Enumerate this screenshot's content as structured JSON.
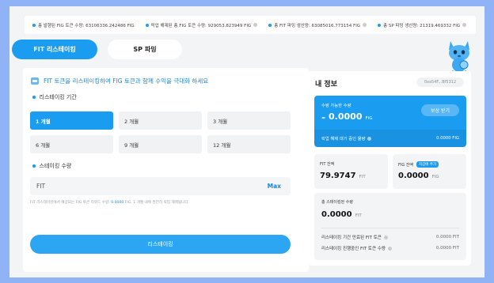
{
  "ticker": [
    {
      "label": "총 발행된 FIG 토큰 수량: 63106336.242486 FIG",
      "help": false
    },
    {
      "label": "락업 해제된 총 FIG 토큰 수량: 929053.823949 FIG",
      "help": true
    },
    {
      "label": "총 FIT 파밍 생산량: 63085016.773154 FIG",
      "help": true
    },
    {
      "label": "총 SP 파밍 생산량: 21319.469332 FIG",
      "help": true
    }
  ],
  "tabs": {
    "active": "FIT 리스테이킹",
    "idle": "SP 파밍"
  },
  "left": {
    "promo": "FIT 토큰을 리스테이킹하여 FIG 토큰과 함께 수익을 극대화 하세요",
    "period_label": "리스테이킹 기간",
    "periods": [
      "1 개월",
      "2 개월",
      "3 개월",
      "6 개월",
      "9 개월",
      "12 개월"
    ],
    "amount_label": "스테이킹 수량",
    "amount_unit": "FIT",
    "amount_max": "Max",
    "note_before": "FIT 리스테이킹에서 예상되는 FIG 토큰 리워드 수량: ",
    "note_value": "0.0000",
    "note_after": " FIG, 1 개월 내에 완전히 락업 해제됩니다.",
    "cta": "리스테이킹"
  },
  "right": {
    "title": "내 정보",
    "wallet": "0xa54F...Bf5312",
    "claimable_label": "수령 가능한 수량",
    "claimable_prefix": "≈",
    "claimable_value": "0.0000",
    "claimable_unit": "FIG",
    "claim_button": "보상 받기",
    "pending_label": "락업 해제 대기 중인 물량",
    "pending_value": "0.0000 FIG",
    "fit_balance_label": "FIT 잔액",
    "fit_balance_value": "79.9747",
    "fit_balance_unit": "FIT",
    "fig_balance_label": "FIG 잔액",
    "fig_badge": "지갑에 추가",
    "fig_balance_value": "0.0000",
    "fig_balance_unit": "FIG",
    "total_label": "총 스테이킹된 수량",
    "total_value": "0.0000",
    "total_unit": "FIT",
    "expired_label": "리스테이킹 기간 만료된 FIT 토큰",
    "expired_value": "0.0000 FIT",
    "active_label": "리스테이킹 진행중인 FIT 토큰 수량",
    "active_value": "0.0000 FIT"
  },
  "colors": {
    "accent": "#1a9cf0",
    "background": "#8fb3f4"
  },
  "icons": {
    "mascot": "blue-cat-mascot-icon",
    "promo": "piggy-bank-icon",
    "help": "question-circle-icon"
  }
}
